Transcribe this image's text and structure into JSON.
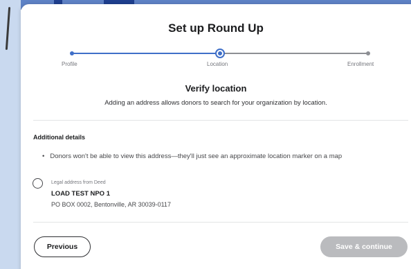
{
  "modal": {
    "title": "Set up Round Up"
  },
  "stepper": {
    "steps": [
      {
        "label": "Profile",
        "state": "completed"
      },
      {
        "label": "Location",
        "state": "current"
      },
      {
        "label": "Enrollment",
        "state": "upcoming"
      }
    ]
  },
  "section": {
    "title": "Verify location",
    "description": "Adding an address allows donors to search for your organization by location."
  },
  "details": {
    "title": "Additional details",
    "bullets": [
      "Donors won't be able to view this address—they'll just see an approximate location marker on a map"
    ]
  },
  "address_option": {
    "caption": "Legal address from Deed",
    "name": "LOAD TEST NPO 1",
    "address": "PO BOX 0002, Bentonville, AR 30039-0117",
    "selected": false
  },
  "footer": {
    "previous_label": "Previous",
    "save_label": "Save & continue",
    "save_enabled": false
  },
  "colors": {
    "accent": "#3f6fc8",
    "disabled_button": "#babbbe",
    "text": "#2e2f32"
  }
}
